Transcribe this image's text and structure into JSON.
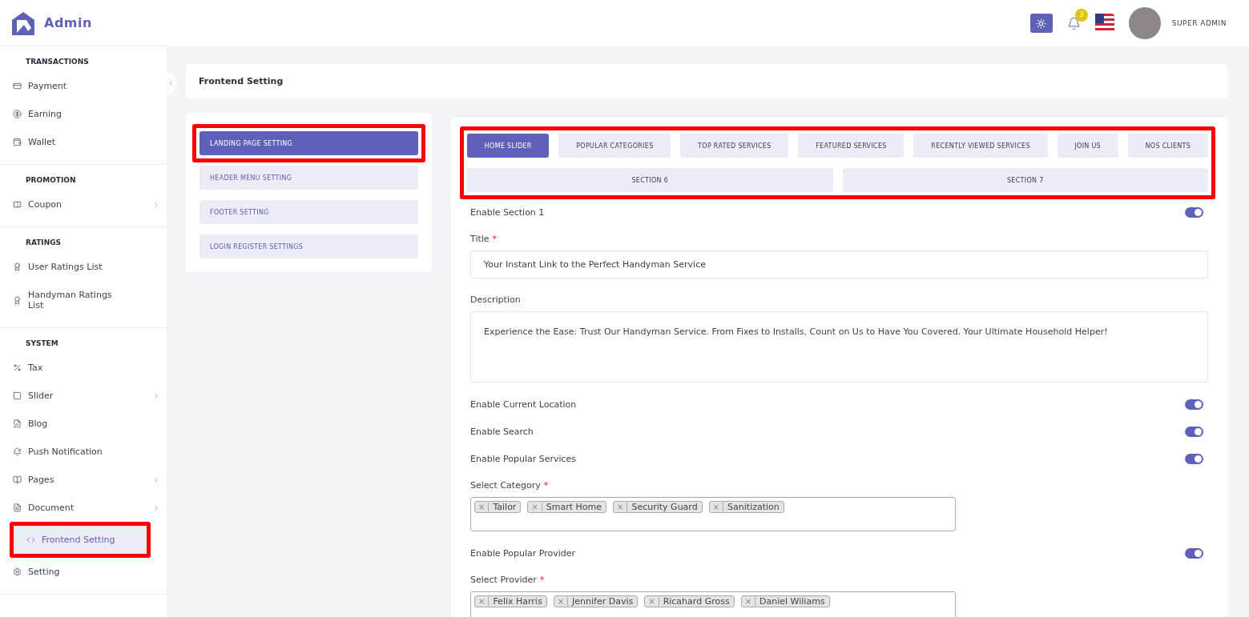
{
  "brand": {
    "name": "Admin"
  },
  "sidebar": {
    "sections": [
      {
        "title": "TRANSACTIONS",
        "items": [
          {
            "label": "Payment",
            "expandable": false,
            "selected": false,
            "annotated": false
          },
          {
            "label": "Earning",
            "expandable": false,
            "selected": false,
            "annotated": false
          },
          {
            "label": "Wallet",
            "expandable": false,
            "selected": false,
            "annotated": false
          }
        ]
      },
      {
        "title": "PROMOTION",
        "items": [
          {
            "label": "Coupon",
            "expandable": true,
            "selected": false,
            "annotated": false
          }
        ]
      },
      {
        "title": "RATINGS",
        "items": [
          {
            "label": "User Ratings List",
            "expandable": false,
            "selected": false,
            "annotated": false
          },
          {
            "label": "Handyman Ratings List",
            "expandable": false,
            "selected": false,
            "annotated": false
          }
        ]
      },
      {
        "title": "SYSTEM",
        "items": [
          {
            "label": "Tax",
            "expandable": false,
            "selected": false,
            "annotated": false
          },
          {
            "label": "Slider",
            "expandable": true,
            "selected": false,
            "annotated": false
          },
          {
            "label": "Blog",
            "expandable": false,
            "selected": false,
            "annotated": false
          },
          {
            "label": "Push Notification",
            "expandable": false,
            "selected": false,
            "annotated": false
          },
          {
            "label": "Pages",
            "expandable": true,
            "selected": false,
            "annotated": false
          },
          {
            "label": "Document",
            "expandable": true,
            "selected": false,
            "annotated": false
          },
          {
            "label": "Frontend Setting",
            "expandable": false,
            "selected": true,
            "annotated": true
          },
          {
            "label": "Setting",
            "expandable": false,
            "selected": false,
            "annotated": false
          }
        ]
      }
    ]
  },
  "topbar": {
    "notification_count": "3",
    "user": "SUPER ADMIN"
  },
  "page_title": "Frontend Setting",
  "settings_menu": [
    {
      "label": "LANDING PAGE SETTING",
      "selected": true,
      "annotated": true
    },
    {
      "label": "HEADER MENU SETTING",
      "selected": false,
      "annotated": false
    },
    {
      "label": "FOOTER SETTING",
      "selected": false,
      "annotated": false
    },
    {
      "label": "LOGIN REGISTER SETTINGS",
      "selected": false,
      "annotated": false
    }
  ],
  "tabs_annotated": true,
  "tabs": [
    [
      {
        "label": "HOME SLIDER",
        "selected": true
      },
      {
        "label": "POPULAR CATEGORIES",
        "selected": false
      },
      {
        "label": "TOP RATED SERVICES",
        "selected": false
      },
      {
        "label": "FEATURED SERVICES",
        "selected": false
      },
      {
        "label": "RECENTLY VIEWED SERVICES",
        "selected": false
      },
      {
        "label": "JOIN US",
        "selected": false
      },
      {
        "label": "NOS CLIENTS",
        "selected": false
      }
    ],
    [
      {
        "label": "SECTION 6",
        "selected": false
      },
      {
        "label": "SECTION 7",
        "selected": false
      }
    ]
  ],
  "form": [
    {
      "kind": "toggle",
      "label": "Enable Section 1",
      "on": true
    },
    {
      "kind": "text",
      "label": "Title",
      "required_mark": "*",
      "value": "Your Instant Link to the Perfect Handyman Service"
    },
    {
      "kind": "textarea",
      "label": "Description",
      "value": "Experience the Ease: Trust Our Handyman Service. From Fixes to Installs, Count on Us to Have You Covered. Your Ultimate Household Helper!"
    },
    {
      "kind": "toggle",
      "label": "Enable Current Location",
      "on": true
    },
    {
      "kind": "toggle",
      "label": "Enable Search",
      "on": true
    },
    {
      "kind": "toggle",
      "label": "Enable Popular Services",
      "on": true
    },
    {
      "kind": "tags",
      "label": "Select Category",
      "required_mark": "*",
      "tags": [
        {
          "remove": "×",
          "label": "Tailor"
        },
        {
          "remove": "×",
          "label": "Smart Home"
        },
        {
          "remove": "×",
          "label": "Security Guard"
        },
        {
          "remove": "×",
          "label": "Sanitization"
        }
      ]
    },
    {
      "kind": "toggle",
      "label": "Enable Popular Provider",
      "on": true
    },
    {
      "kind": "tags",
      "label": "Select Provider",
      "required_mark": "*",
      "tags": [
        {
          "remove": "×",
          "label": "Felix Harris"
        },
        {
          "remove": "×",
          "label": "Jennifer Davis"
        },
        {
          "remove": "×",
          "label": "Ricahard Gross"
        },
        {
          "remove": "×",
          "label": "Daniel Wiliams"
        }
      ]
    }
  ]
}
